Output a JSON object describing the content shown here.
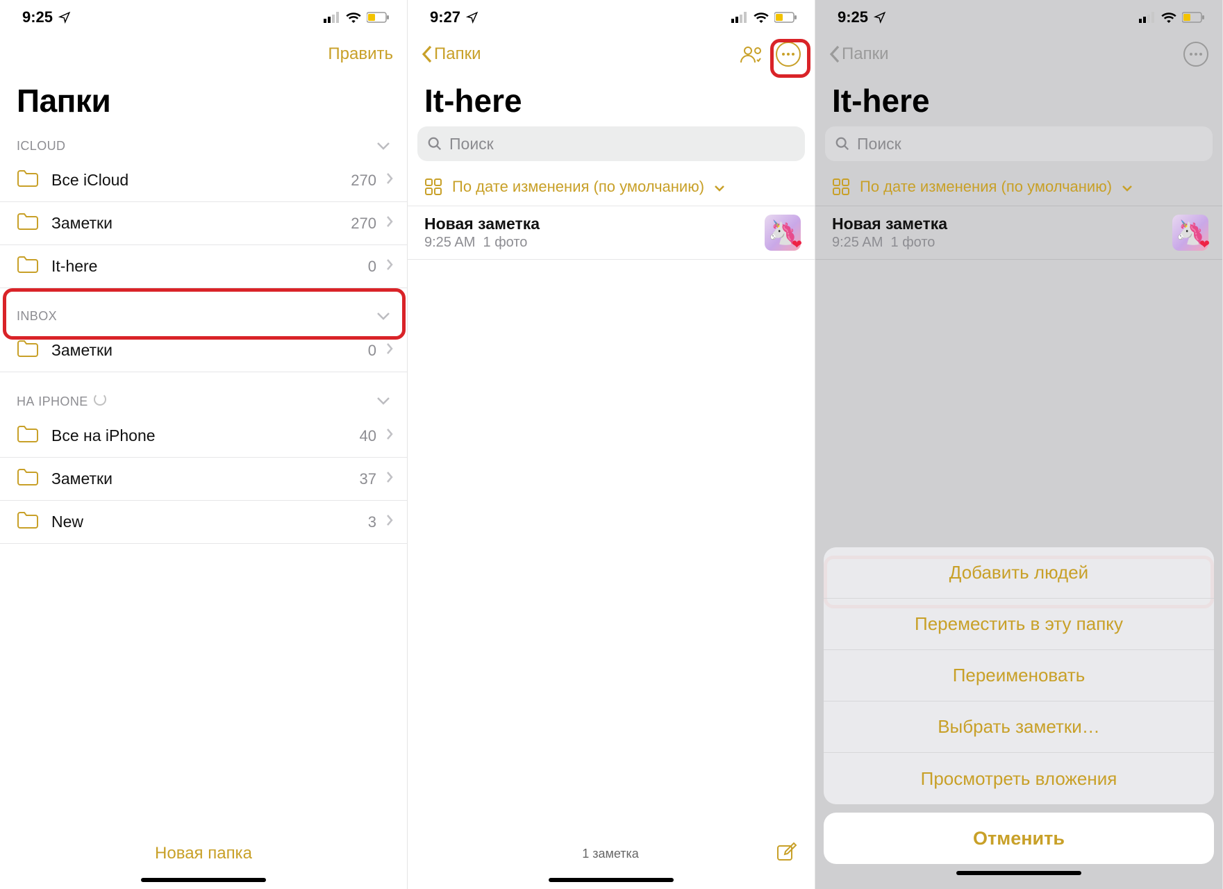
{
  "colors": {
    "accent": "#c8a028",
    "red": "#d92328"
  },
  "screen1": {
    "time": "9:25",
    "nav": {
      "edit": "Править"
    },
    "title": "Папки",
    "sections": [
      {
        "header": "ICLOUD",
        "items": [
          {
            "label": "Все iCloud",
            "count": "270"
          },
          {
            "label": "Заметки",
            "count": "270"
          },
          {
            "label": "It-here",
            "count": "0"
          }
        ]
      },
      {
        "header": "INBOX",
        "items": [
          {
            "label": "Заметки",
            "count": "0"
          }
        ]
      },
      {
        "header": "НА IPHONE",
        "loading": true,
        "items": [
          {
            "label": "Все на iPhone",
            "count": "40"
          },
          {
            "label": "Заметки",
            "count": "37"
          },
          {
            "label": "New",
            "count": "3"
          }
        ]
      }
    ],
    "newFolder": "Новая папка"
  },
  "screen2": {
    "time": "9:27",
    "nav": {
      "back": "Папки"
    },
    "title": "It-here",
    "search": "Поиск",
    "sortLabel": "По дате изменения (по умолчанию)",
    "note": {
      "title": "Новая заметка",
      "time": "9:25 AM",
      "photo": "1 фото"
    },
    "notesCount": "1 заметка"
  },
  "screen3": {
    "time": "9:25",
    "nav": {
      "back": "Папки"
    },
    "title": "It-here",
    "search": "Поиск",
    "sortLabel": "По дате изменения (по умолчанию)",
    "note": {
      "title": "Новая заметка",
      "time": "9:25 AM",
      "photo": "1 фото"
    },
    "sheet": {
      "items": [
        "Добавить людей",
        "Переместить в эту папку",
        "Переименовать",
        "Выбрать заметки…",
        "Просмотреть вложения"
      ],
      "cancel": "Отменить"
    }
  }
}
